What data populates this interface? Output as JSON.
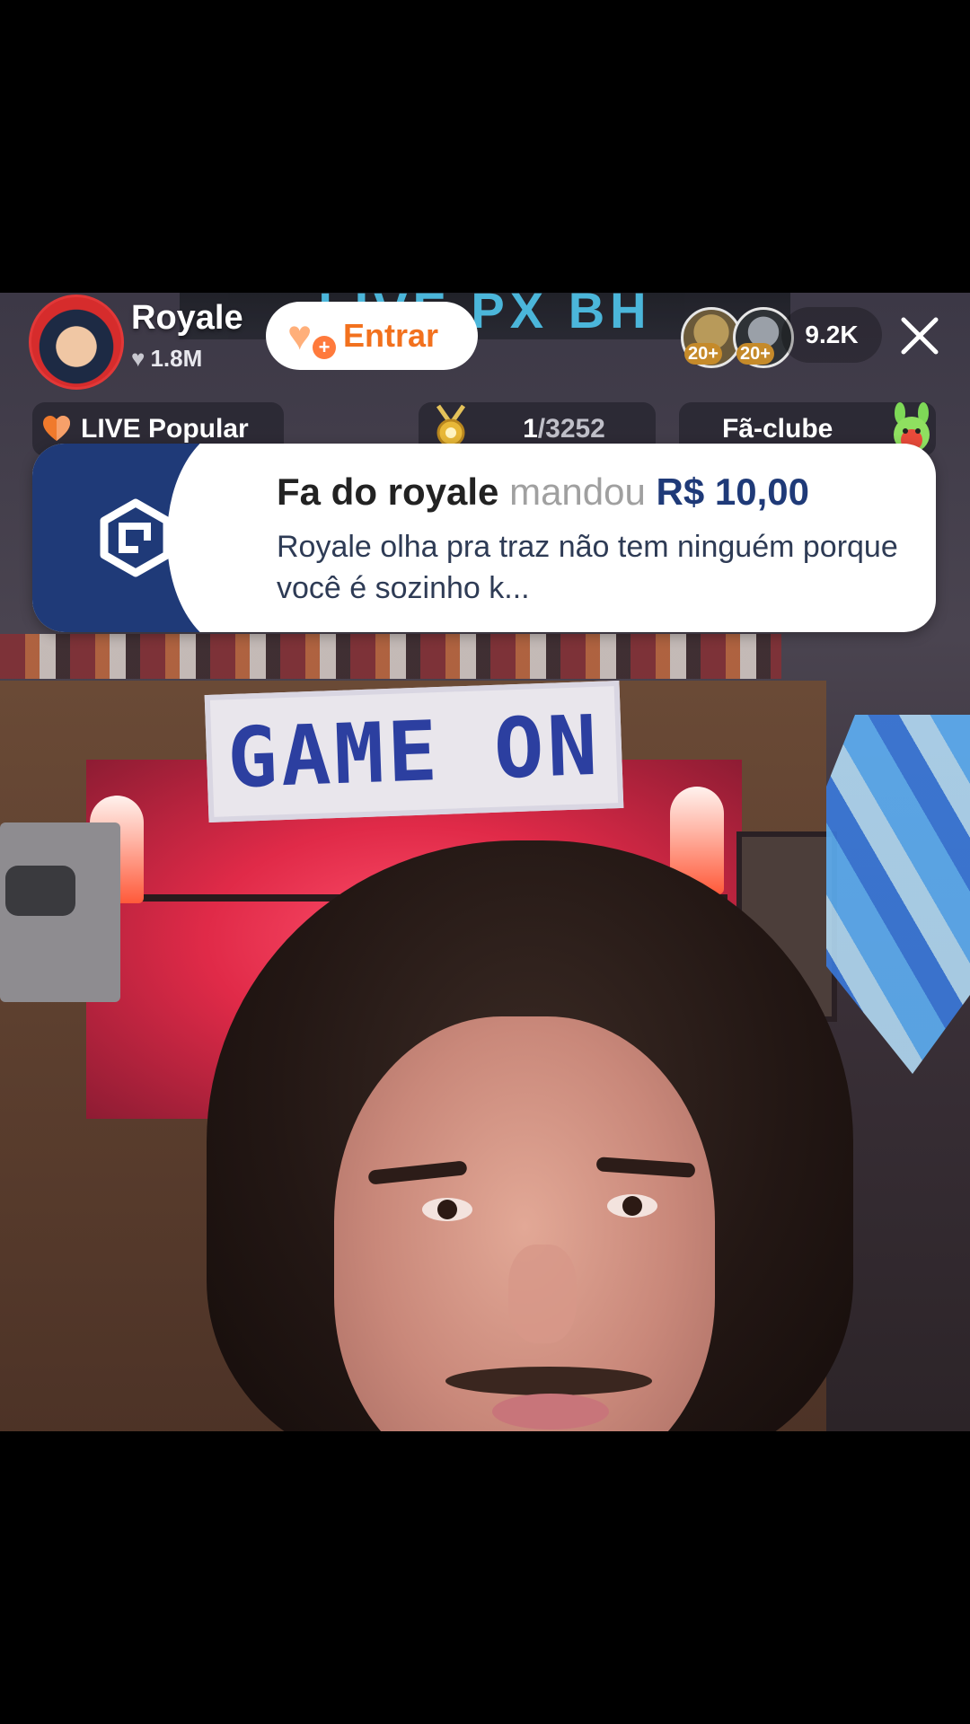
{
  "stream": {
    "wall_sign": "GAME ON",
    "banner_text": "LIVE PX BH"
  },
  "header": {
    "host_name": "Royale",
    "host_likes": "1.8M",
    "join_label": "Entrar",
    "viewer_badges": [
      "20+",
      "20+"
    ],
    "viewer_count": "9.2K"
  },
  "badges": {
    "live_popular": "LIVE Popular",
    "rank_current": "1",
    "rank_total": "/3252",
    "fan_club": "Fã-clube"
  },
  "gift": {
    "sender": "Fa do royale",
    "verb": "mandou",
    "amount": "R$ 10,00",
    "message": "Royale olha pra traz não tem ninguém porque você é sozinho k..."
  },
  "colors": {
    "accent_orange": "#f2711e",
    "gift_navy": "#1f3a78"
  },
  "icons": {
    "close": "close-icon",
    "join": "heart-plus-icon",
    "live": "heart-icon",
    "rank": "medal-icon",
    "fan": "mascot-icon",
    "gift": "payment-logo-icon"
  }
}
